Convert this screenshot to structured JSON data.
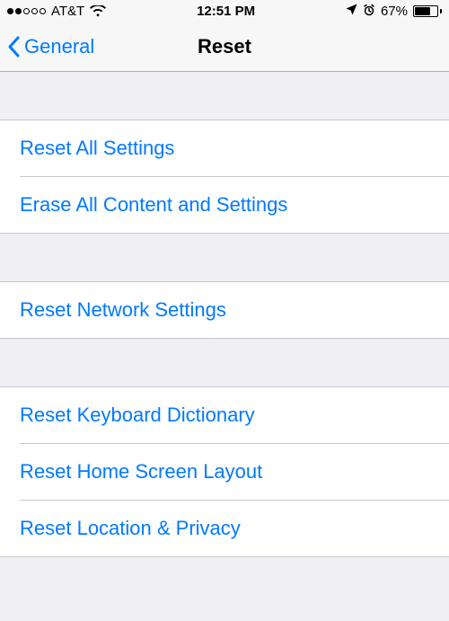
{
  "statusbar": {
    "carrier": "AT&T",
    "time": "12:51 PM",
    "battery_pct": "67%"
  },
  "navbar": {
    "back_label": "General",
    "title": "Reset"
  },
  "groups": [
    {
      "items": [
        {
          "label": "Reset All Settings"
        },
        {
          "label": "Erase All Content and Settings"
        }
      ]
    },
    {
      "items": [
        {
          "label": "Reset Network Settings"
        }
      ]
    },
    {
      "items": [
        {
          "label": "Reset Keyboard Dictionary"
        },
        {
          "label": "Reset Home Screen Layout"
        },
        {
          "label": "Reset Location & Privacy"
        }
      ]
    }
  ]
}
